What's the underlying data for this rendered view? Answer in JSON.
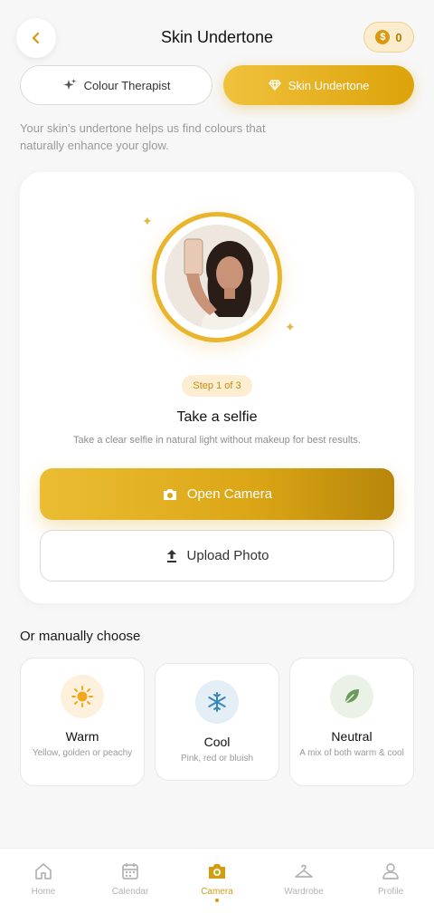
{
  "header": {
    "title": "Skin Undertone",
    "coins": "0",
    "coin_symbol": "$"
  },
  "tabs": [
    {
      "label": "Colour Therapist",
      "icon": "sparkles-icon"
    },
    {
      "label": "Skin Undertone",
      "icon": "diamond-icon",
      "active": true
    }
  ],
  "intro": "Your skin's undertone helps us find colours that naturally enhance your glow.",
  "selfie": {
    "step": "Step 1 of 3",
    "title": "Take a selfie",
    "description": "Take a clear selfie in natural light without makeup for best results.",
    "open_camera_label": "Open Camera",
    "upload_label": "Upload Photo"
  },
  "manual": {
    "title": "Or manually choose",
    "options": [
      {
        "name": "Warm",
        "description": "Yellow, golden or peachy",
        "icon": "sun-icon",
        "color": "#f2a81d",
        "bg": "#fdf0dc"
      },
      {
        "name": "Cool",
        "description": "Pink, red or bluish",
        "icon": "snowflake-icon",
        "color": "#3b86b8",
        "bg": "#e3eef7"
      },
      {
        "name": "Neutral",
        "description": "A mix of both warm & cool",
        "icon": "leaf-icon",
        "color": "#6a9a5a",
        "bg": "#eaf1e7"
      }
    ]
  },
  "nav": [
    {
      "label": "Home",
      "icon": "home-icon"
    },
    {
      "label": "Calendar",
      "icon": "calendar-icon"
    },
    {
      "label": "Camera",
      "icon": "camera-icon",
      "active": true
    },
    {
      "label": "Wardrobe",
      "icon": "hanger-icon"
    },
    {
      "label": "Profile",
      "icon": "profile-icon"
    }
  ],
  "colors": {
    "accent": "#dca30a",
    "accent_light": "#fdeed2"
  }
}
